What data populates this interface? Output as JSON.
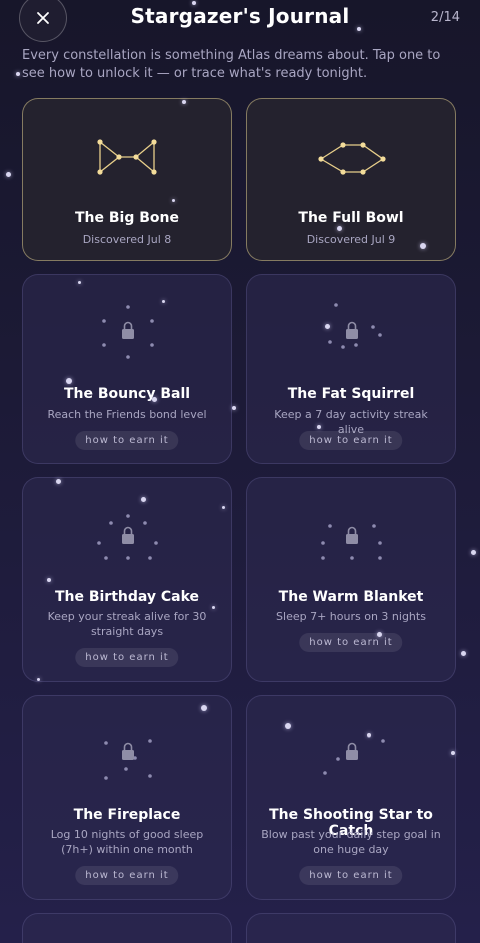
{
  "header": {
    "title": "Stargazer's Journal",
    "counter": "2/14",
    "close_icon": "close-icon"
  },
  "intro": "Every constellation is something Atlas dreams about. Tap one to see how to unlock it — or trace what's ready tonight.",
  "colors": {
    "constellation_line": "#e8cf8a",
    "constellation_star": "#f3dc9a",
    "locked_dot": "#8e8bb0",
    "lock_icon": "#8f8da6"
  },
  "cards": [
    {
      "title": "The Big Bone",
      "subtitle": "Discovered Jul 8",
      "status": "discovered",
      "icon": "bone-constellation-icon"
    },
    {
      "title": "The Full Bowl",
      "subtitle": "Discovered Jul 9",
      "status": "discovered",
      "icon": "bowl-constellation-icon"
    },
    {
      "title": "The Bouncy Ball",
      "subtitle": "Reach the Friends bond level",
      "status": "locked",
      "button": "how to earn it",
      "icon": "lock-icon"
    },
    {
      "title": "The Fat Squirrel",
      "subtitle": "Keep a 7 day activity streak alive",
      "status": "locked",
      "button": "how to earn it",
      "icon": "lock-icon"
    },
    {
      "title": "The Birthday Cake",
      "subtitle": "Keep your streak alive for 30 straight days",
      "status": "locked",
      "button": "how to earn it",
      "icon": "lock-icon"
    },
    {
      "title": "The Warm Blanket",
      "subtitle": "Sleep 7+ hours on 3 nights",
      "status": "locked",
      "button": "how to earn it",
      "icon": "lock-icon"
    },
    {
      "title": "The Fireplace",
      "subtitle": "Log 10 nights of good sleep (7h+) within one month",
      "status": "locked",
      "button": "how to earn it",
      "icon": "lock-icon"
    },
    {
      "title": "The Shooting Star to Catch",
      "subtitle": "Blow past your daily step goal in one huge day",
      "status": "locked",
      "button": "how to earn it",
      "icon": "lock-icon"
    }
  ]
}
